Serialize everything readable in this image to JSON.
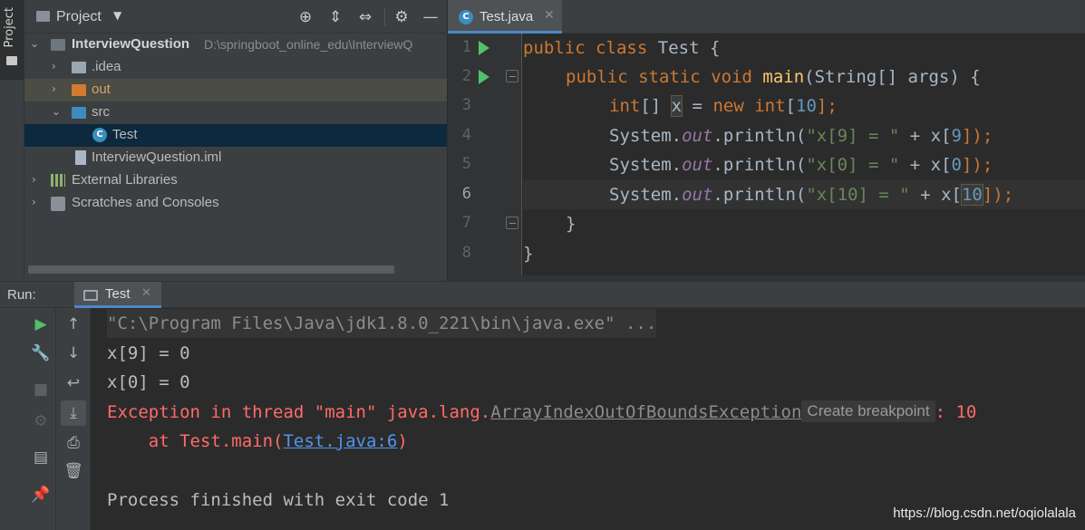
{
  "side_tab": {
    "label": "Project"
  },
  "project_panel": {
    "title": "Project",
    "tree": [
      {
        "label": "InterviewQuestion",
        "path": "D:\\springboot_online_edu\\InterviewQ"
      },
      {
        "label": ".idea"
      },
      {
        "label": "out"
      },
      {
        "label": "src"
      },
      {
        "label": "Test"
      },
      {
        "label": "InterviewQuestion.iml"
      },
      {
        "label": "External Libraries"
      },
      {
        "label": "Scratches and Consoles"
      }
    ]
  },
  "editor": {
    "tab_label": "Test.java",
    "current_line": 6,
    "line_numbers": [
      "1",
      "2",
      "3",
      "4",
      "5",
      "6",
      "7",
      "8"
    ],
    "code": {
      "l1": {
        "kw1": "public",
        "kw2": "class",
        "name": "Test",
        "brace": "{"
      },
      "l2": {
        "kw1": "public",
        "kw2": "static",
        "kw3": "void",
        "fn": "main",
        "params": "(String[] args) {"
      },
      "l3": {
        "type": "int",
        "arr": "[] ",
        "var": "x",
        "eq": " = ",
        "kw": "new",
        "type2": "int",
        "open": "[",
        "num": "10",
        "close": "];"
      },
      "l4": {
        "sys": "System.",
        "out": "out",
        "call": ".println(",
        "str": "\"x[9] = \"",
        "plus": " + x[",
        "num": "9",
        "end": "]);"
      },
      "l5": {
        "sys": "System.",
        "out": "out",
        "call": ".println(",
        "str": "\"x[0] = \"",
        "plus": " + x[",
        "num": "0",
        "end": "]);"
      },
      "l6": {
        "sys": "System.",
        "out": "out",
        "call": ".println(",
        "str": "\"x[10] = \"",
        "plus": " + x[",
        "num": "10",
        "end": "]);"
      },
      "l7": {
        "brace": "}"
      },
      "l8": {
        "brace": "}"
      }
    }
  },
  "run_panel": {
    "label": "Run:",
    "tab_label": "Test",
    "output": {
      "cmd": "\"C:\\Program Files\\Java\\jdk1.8.0_221\\bin\\java.exe\" ...",
      "line1": "x[9] = 0",
      "line2": "x[0] = 0",
      "exc_prefix": "Exception in thread \"main\" java.lang.",
      "exc_class": "ArrayIndexOutOfBoundsException",
      "breakpoint_hint": "Create breakpoint",
      "exc_suffix": ": 10",
      "at_prefix": "    at Test.main(",
      "at_link": "Test.java:6",
      "at_suffix": ")",
      "finish": "Process finished with exit code 1"
    }
  },
  "watermark": "https://blog.csdn.net/oqiolalala",
  "colors": {
    "keyword": "#cc7832",
    "string": "#6a8759",
    "number": "#6897bb",
    "function": "#ffc66d",
    "error": "#ff6b68",
    "link": "#5394ec",
    "run_green": "#4fc26a"
  }
}
